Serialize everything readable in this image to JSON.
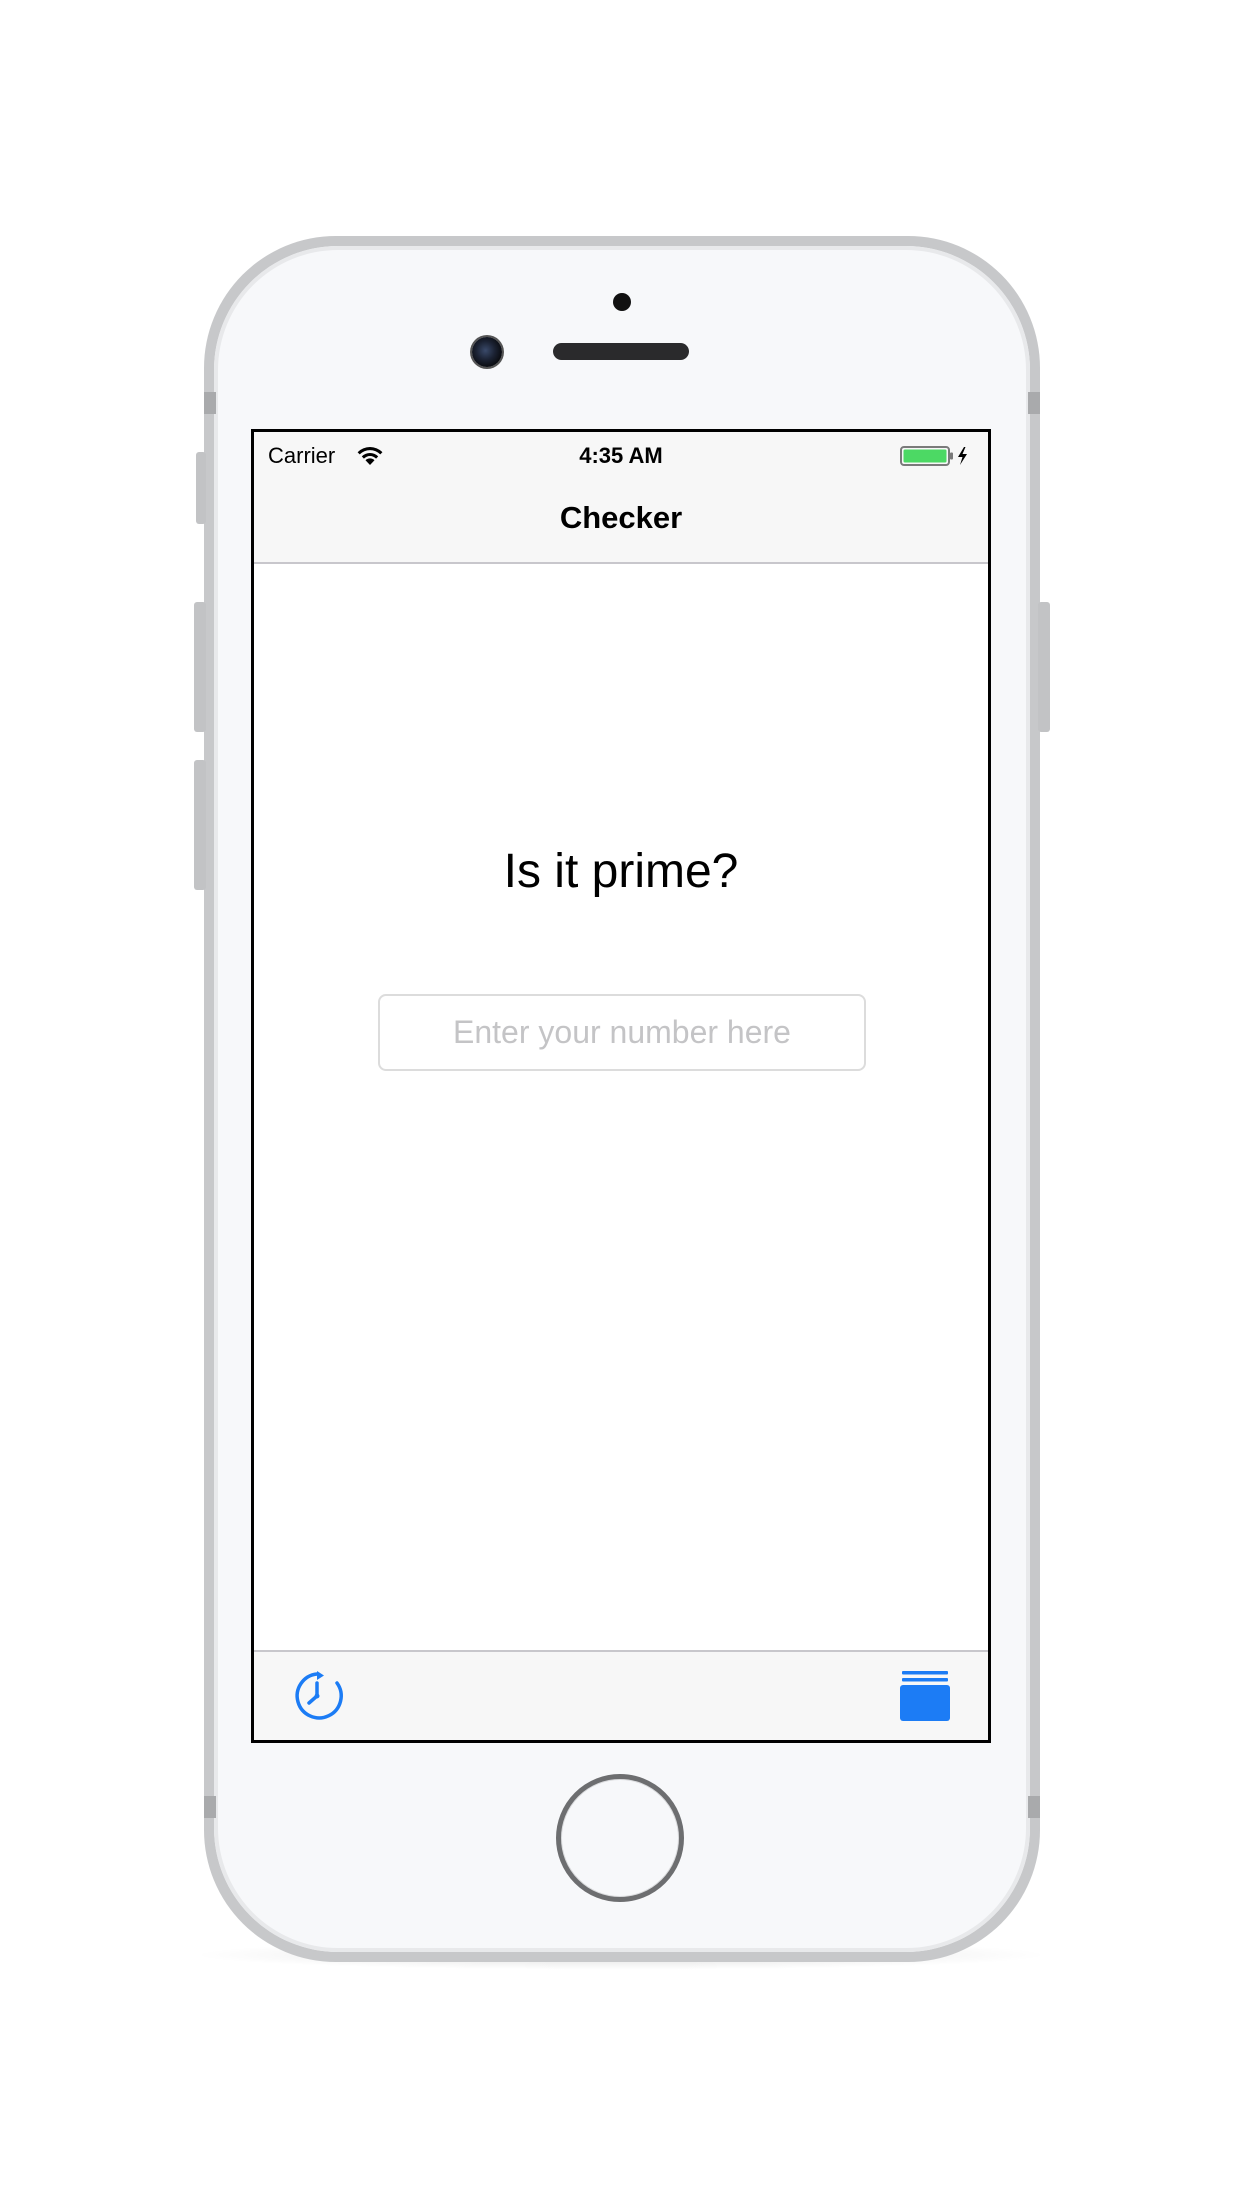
{
  "status_bar": {
    "carrier": "Carrier",
    "time": "4:35 AM",
    "battery_color": "#4cd964"
  },
  "nav": {
    "title": "Checker"
  },
  "main": {
    "headline": "Is it prime?",
    "number_input": {
      "value": "",
      "placeholder": "Enter your number here"
    }
  },
  "tab_bar": {
    "accent_color": "#1c7cf5",
    "items": [
      {
        "icon": "history-clock-icon"
      },
      {
        "icon": "stack-icon"
      }
    ]
  }
}
